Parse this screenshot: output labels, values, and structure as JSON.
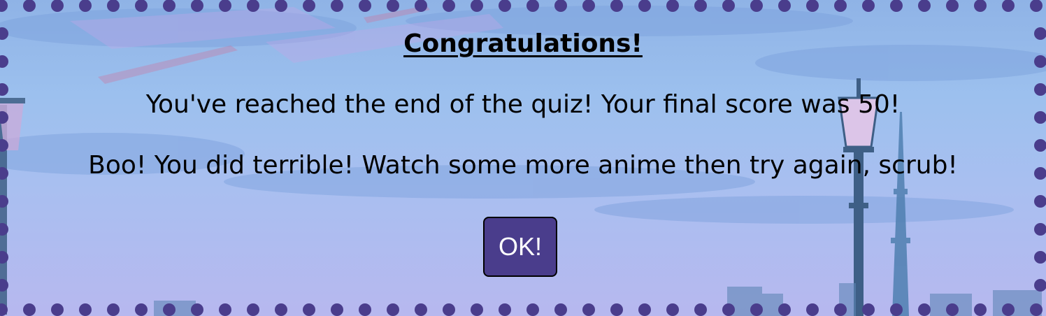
{
  "modal": {
    "title": "Congratulations!",
    "score_message": "You've reached the end of the quiz! Your final score was 50!",
    "verdict_message": "Boo! You did terrible! Watch some more anime then try again, scrub!",
    "ok_label": "OK!"
  },
  "colors": {
    "border_dots": "#4a3d8c",
    "button_bg": "#4a3d8c",
    "button_text": "#ffffff",
    "text": "#000000"
  }
}
